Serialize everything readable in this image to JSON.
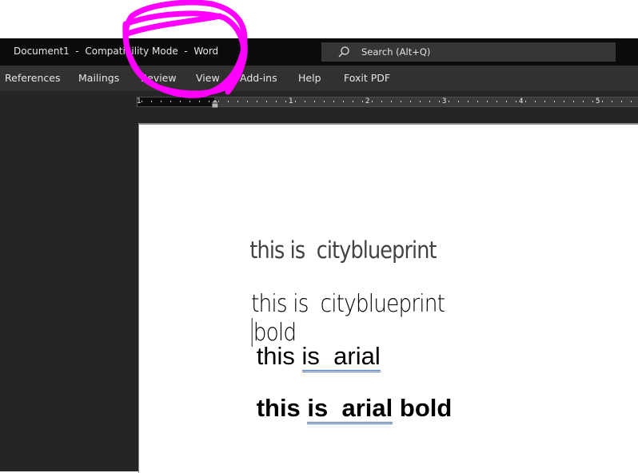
{
  "window": {
    "title": "Document1  -  Compatibility Mode  -  Word"
  },
  "search": {
    "placeholder": "Search (Alt+Q)",
    "icon": "search-icon"
  },
  "ribbon": {
    "tabs": [
      {
        "label": "References"
      },
      {
        "label": "Mailings"
      },
      {
        "label": "Review"
      },
      {
        "label": "View"
      },
      {
        "label": "Add-ins"
      },
      {
        "label": "Help"
      },
      {
        "label": "Foxit PDF"
      }
    ]
  },
  "ruler": {
    "numbers": [
      "1",
      "1",
      "2",
      "3",
      "4",
      "5"
    ]
  },
  "document": {
    "lines": [
      {
        "parts": [
          "this is  cityblueprint"
        ]
      },
      {
        "parts": [
          "this is  cityblueprint",
          "bold"
        ]
      },
      {
        "parts": [
          "this ",
          "is  arial"
        ]
      },
      {
        "parts": [
          "this ",
          "is  arial",
          " bold"
        ]
      }
    ]
  },
  "annotation": {
    "color": "#ff00ff"
  }
}
